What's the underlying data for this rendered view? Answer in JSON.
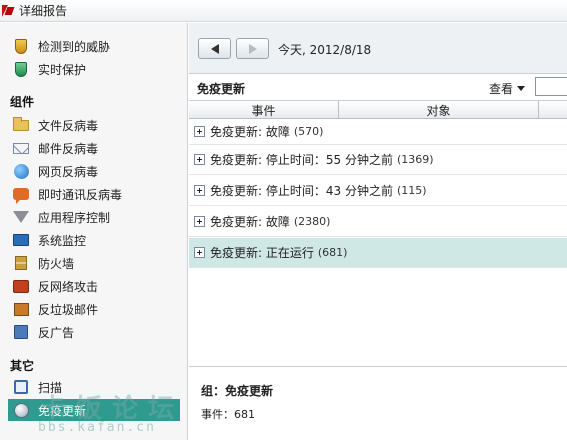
{
  "window": {
    "title": "详细报告"
  },
  "sidebar": {
    "top_items": [
      {
        "label": "检测到的威胁",
        "icon": "shield-threat-icon"
      },
      {
        "label": "实时保护",
        "icon": "shield-protect-icon"
      }
    ],
    "components_heading": "组件",
    "components": [
      {
        "label": "文件反病毒",
        "icon": "folder-icon"
      },
      {
        "label": "邮件反病毒",
        "icon": "mail-icon"
      },
      {
        "label": "网页反病毒",
        "icon": "globe-icon"
      },
      {
        "label": "即时通讯反病毒",
        "icon": "chat-icon"
      },
      {
        "label": "应用程序控制",
        "icon": "funnel-icon"
      },
      {
        "label": "系统监控",
        "icon": "monitor-icon"
      },
      {
        "label": "防火墙",
        "icon": "firewall-icon"
      },
      {
        "label": "反网络攻击",
        "icon": "network-attack-icon"
      },
      {
        "label": "反垃圾邮件",
        "icon": "anti-spam-icon"
      },
      {
        "label": "反广告",
        "icon": "anti-banner-icon"
      }
    ],
    "other_heading": "其它",
    "other": [
      {
        "label": "扫描",
        "icon": "scan-icon"
      },
      {
        "label": "免疫更新",
        "icon": "update-icon",
        "selected": true
      }
    ]
  },
  "nav": {
    "back_icon": "back-arrow-icon",
    "forward_icon": "forward-arrow-icon",
    "date_text": "今天, 2012/8/18"
  },
  "section": {
    "title": "免疫更新",
    "view_label": "查看",
    "search_value": ""
  },
  "columns": {
    "event": "事件",
    "object": "对象"
  },
  "rows": [
    {
      "text": "免疫更新: 故障",
      "count": "(570)"
    },
    {
      "text": "免疫更新: 停止时间：55 分钟之前",
      "count": "(1369)"
    },
    {
      "text": "免疫更新: 停止时间：43 分钟之前",
      "count": "(115)"
    },
    {
      "text": "免疫更新: 故障",
      "count": "(2380)"
    },
    {
      "text": "免疫更新: 正在运行",
      "count": "(681)",
      "selected": true
    }
  ],
  "details": {
    "group_line": "组：免疫更新",
    "events_line": "事件：681"
  },
  "watermark": {
    "main": "卡饭论坛",
    "sub": "bbs.kafan.cn"
  },
  "colors": {
    "accent": "#2f9a8f",
    "selected_row": "#cfe8e6"
  }
}
